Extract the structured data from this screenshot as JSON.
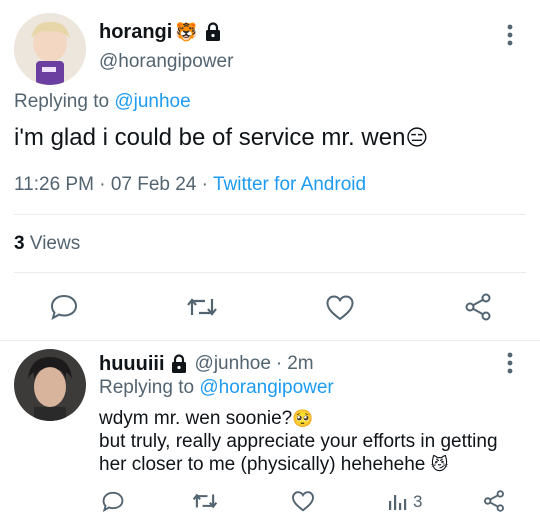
{
  "colors": {
    "accent": "#1d9bf0",
    "muted": "#536471",
    "text": "#0f1419",
    "divider": "#e6ecf0"
  },
  "main_tweet": {
    "author": {
      "display_name": "horangi",
      "emoji": "🐯",
      "badge_icon": "lock-icon",
      "handle": "@horangipower"
    },
    "replying_to_label": "Replying to",
    "replying_to_handle": "@junhoe",
    "text": "i'm glad i could be of service mr. wen",
    "text_emoji": "😑",
    "time": "11:26 PM",
    "date": "07 Feb 24",
    "source": "Twitter for Android",
    "views_count": "3",
    "views_label": "Views"
  },
  "reply": {
    "author": {
      "display_name": "huuuiii",
      "badge_icon": "lock-icon",
      "handle": "@junhoe",
      "time_ago": "2m"
    },
    "replying_to_label": "Replying to",
    "replying_to_handle": "@horangipower",
    "lines": [
      "wdym mr. wen soonie?",
      "but truly, really appreciate your efforts in getting",
      "her closer to me (physically) hehehehe"
    ],
    "line1_emoji": "🥺",
    "line3_emoji": "😼",
    "views_count": "3"
  },
  "separators": {
    "dot": "·"
  }
}
